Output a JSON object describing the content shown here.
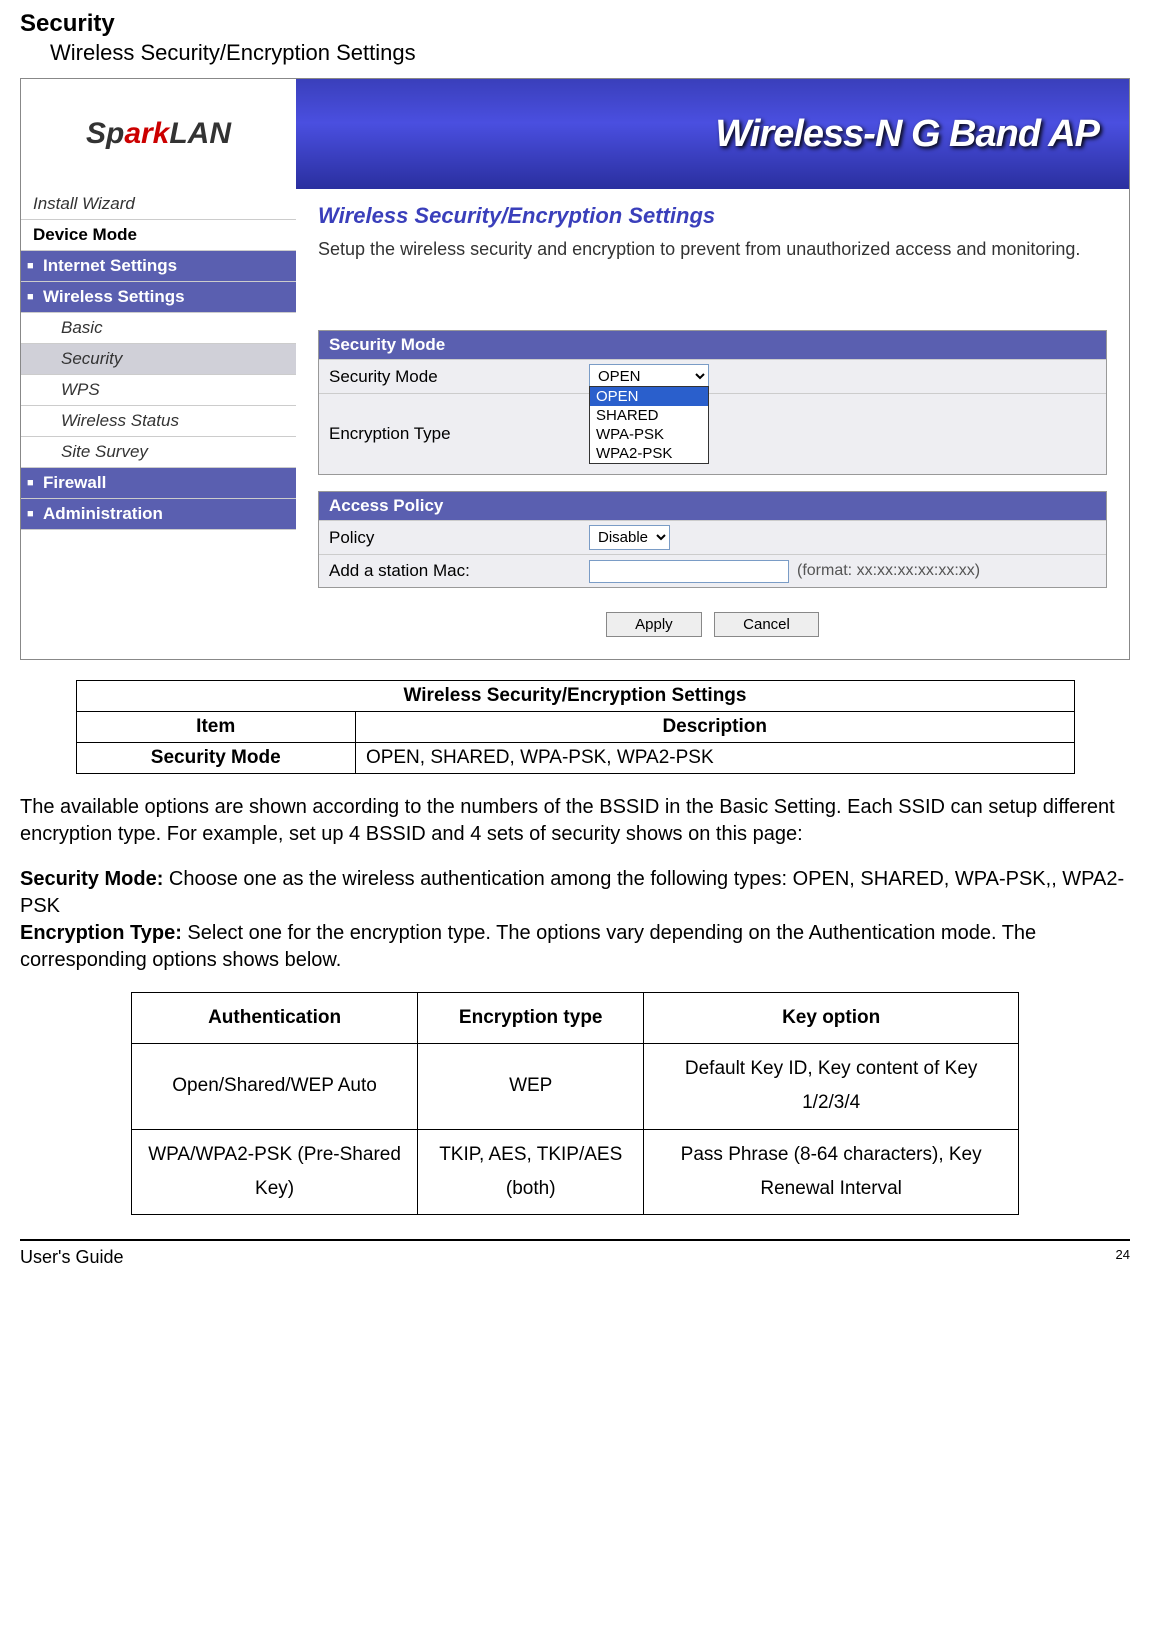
{
  "header": {
    "title": "Security",
    "subtitle": "Wireless Security/Encryption Settings"
  },
  "banner": {
    "logo_part1": "Sp",
    "logo_part2": "ark",
    "logo_part3": "LAN",
    "title": "Wireless-N G Band AP"
  },
  "sidebar": {
    "install": "Install Wizard",
    "device": "Device Mode",
    "internet": "Internet Settings",
    "wireless": "Wireless Settings",
    "basic": "Basic",
    "security": "Security",
    "wps": "WPS",
    "status": "Wireless Status",
    "survey": "Site Survey",
    "firewall": "Firewall",
    "admin": "Administration"
  },
  "content": {
    "heading": "Wireless Security/Encryption Settings",
    "desc": "Setup the wireless security and encryption to prevent from unauthorized access and monitoring.",
    "sec_mode_panel": "Security Mode",
    "sec_mode_label": "Security Mode",
    "sec_mode_value": "OPEN",
    "sec_mode_options": {
      "o1": "OPEN",
      "o2": "SHARED",
      "o3": "WPA-PSK",
      "o4": "WPA2-PSK"
    },
    "enc_type_label": "Encryption Type",
    "access_panel": "Access Policy",
    "policy_label": "Policy",
    "policy_value": "Disable",
    "mac_label": "Add a station Mac:",
    "mac_format": "(format: xx:xx:xx:xx:xx:xx)",
    "apply": "Apply",
    "cancel": "Cancel"
  },
  "table1": {
    "caption": "Wireless Security/Encryption Settings",
    "h1": "Item",
    "h2": "Description",
    "r1c1": "Security Mode",
    "r1c2": "OPEN, SHARED, WPA-PSK, WPA2-PSK"
  },
  "para1": "The available options are shown according to the numbers of the BSSID in the Basic Setting. Each SSID can setup different encryption type. For example, set up 4 BSSID and 4 sets of security shows on this page:",
  "para2": {
    "s1": "Security Mode:",
    "s1t": " Choose one as the wireless authentication among the following types: OPEN, SHARED, WPA-PSK,, WPA2-PSK",
    "s2": "Encryption Type:",
    "s2t": " Select one for the encryption type. The options vary depending on the Authentication mode. The corresponding options shows below."
  },
  "table2": {
    "h1": "Authentication",
    "h2": "Encryption type",
    "h3": "Key option",
    "r1c1": "Open/Shared/WEP Auto",
    "r1c2": "WEP",
    "r1c3": "Default Key ID, Key content of Key 1/2/3/4",
    "r2c1": "WPA/WPA2-PSK (Pre-Shared Key)",
    "r2c2": "TKIP, AES, TKIP/AES (both)",
    "r2c3": "Pass Phrase (8-64 characters), Key Renewal Interval"
  },
  "footer": {
    "guide": "User's Guide",
    "page": "24"
  }
}
